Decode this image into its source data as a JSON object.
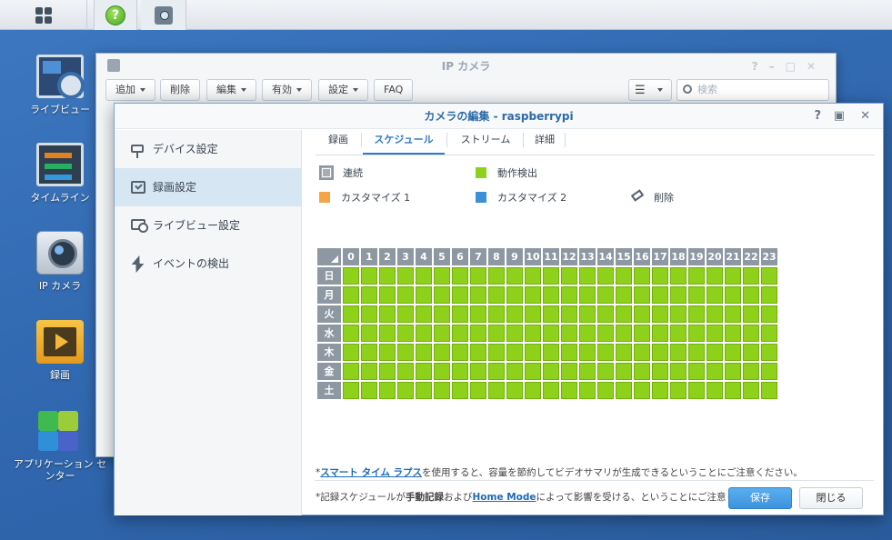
{
  "taskbar": {
    "help_glyph": "?"
  },
  "desktop": {
    "icons": [
      {
        "label": "ライブビュー",
        "icon": "live-view-icon"
      },
      {
        "label": "タイムライン",
        "icon": "timeline-icon"
      },
      {
        "label": "IP カメラ",
        "icon": "ip-camera-icon"
      },
      {
        "label": "録画",
        "icon": "recording-icon"
      },
      {
        "label": "アプリケーション センター",
        "icon": "app-center-icon"
      }
    ]
  },
  "bg_window": {
    "title": "IP カメラ",
    "toolbar": {
      "add": "追加",
      "delete": "削除",
      "edit": "編集",
      "enable": "有効",
      "settings": "設定",
      "faq": "FAQ"
    },
    "search_placeholder": "検索"
  },
  "dialog": {
    "title": "カメラの編集 - raspberrypi",
    "sidebar": [
      {
        "label": "デバイス設定"
      },
      {
        "label": "録画設定"
      },
      {
        "label": "ライブビュー設定"
      },
      {
        "label": "イベントの検出"
      }
    ],
    "tabs": [
      "録画",
      "スケジュール",
      "ストリーム",
      "詳細"
    ],
    "active_tab": "スケジュール",
    "legend": {
      "continuous": "連続",
      "motion": "動作検出",
      "custom1": "カスタマイズ 1",
      "custom2": "カスタマイズ 2",
      "erase": "削除"
    },
    "colors": {
      "continuous": "#a6adb5",
      "motion": "#8ed11a",
      "custom1": "#f5a446",
      "custom2": "#3d8fd6"
    },
    "schedule": {
      "hours": [
        "0",
        "1",
        "2",
        "3",
        "4",
        "5",
        "6",
        "7",
        "8",
        "9",
        "10",
        "11",
        "12",
        "13",
        "14",
        "15",
        "16",
        "17",
        "18",
        "19",
        "20",
        "21",
        "22",
        "23"
      ],
      "days": [
        "日",
        "月",
        "火",
        "水",
        "木",
        "金",
        "土"
      ],
      "mode": "motion"
    },
    "note1": {
      "prefix": "*",
      "link": "スマート タイム ラプス",
      "suffix": "を使用すると、容量を節約してビデオサマリが生成できるということにご注意ください。"
    },
    "note2": {
      "prefix": "*記録スケジュールが",
      "bold": "手動記録",
      "mid": "および",
      "link": "Home Mode",
      "suffix": "によって影響を受ける、ということにご注意ください。"
    },
    "buttons": {
      "save": "保存",
      "close": "閉じる"
    }
  }
}
